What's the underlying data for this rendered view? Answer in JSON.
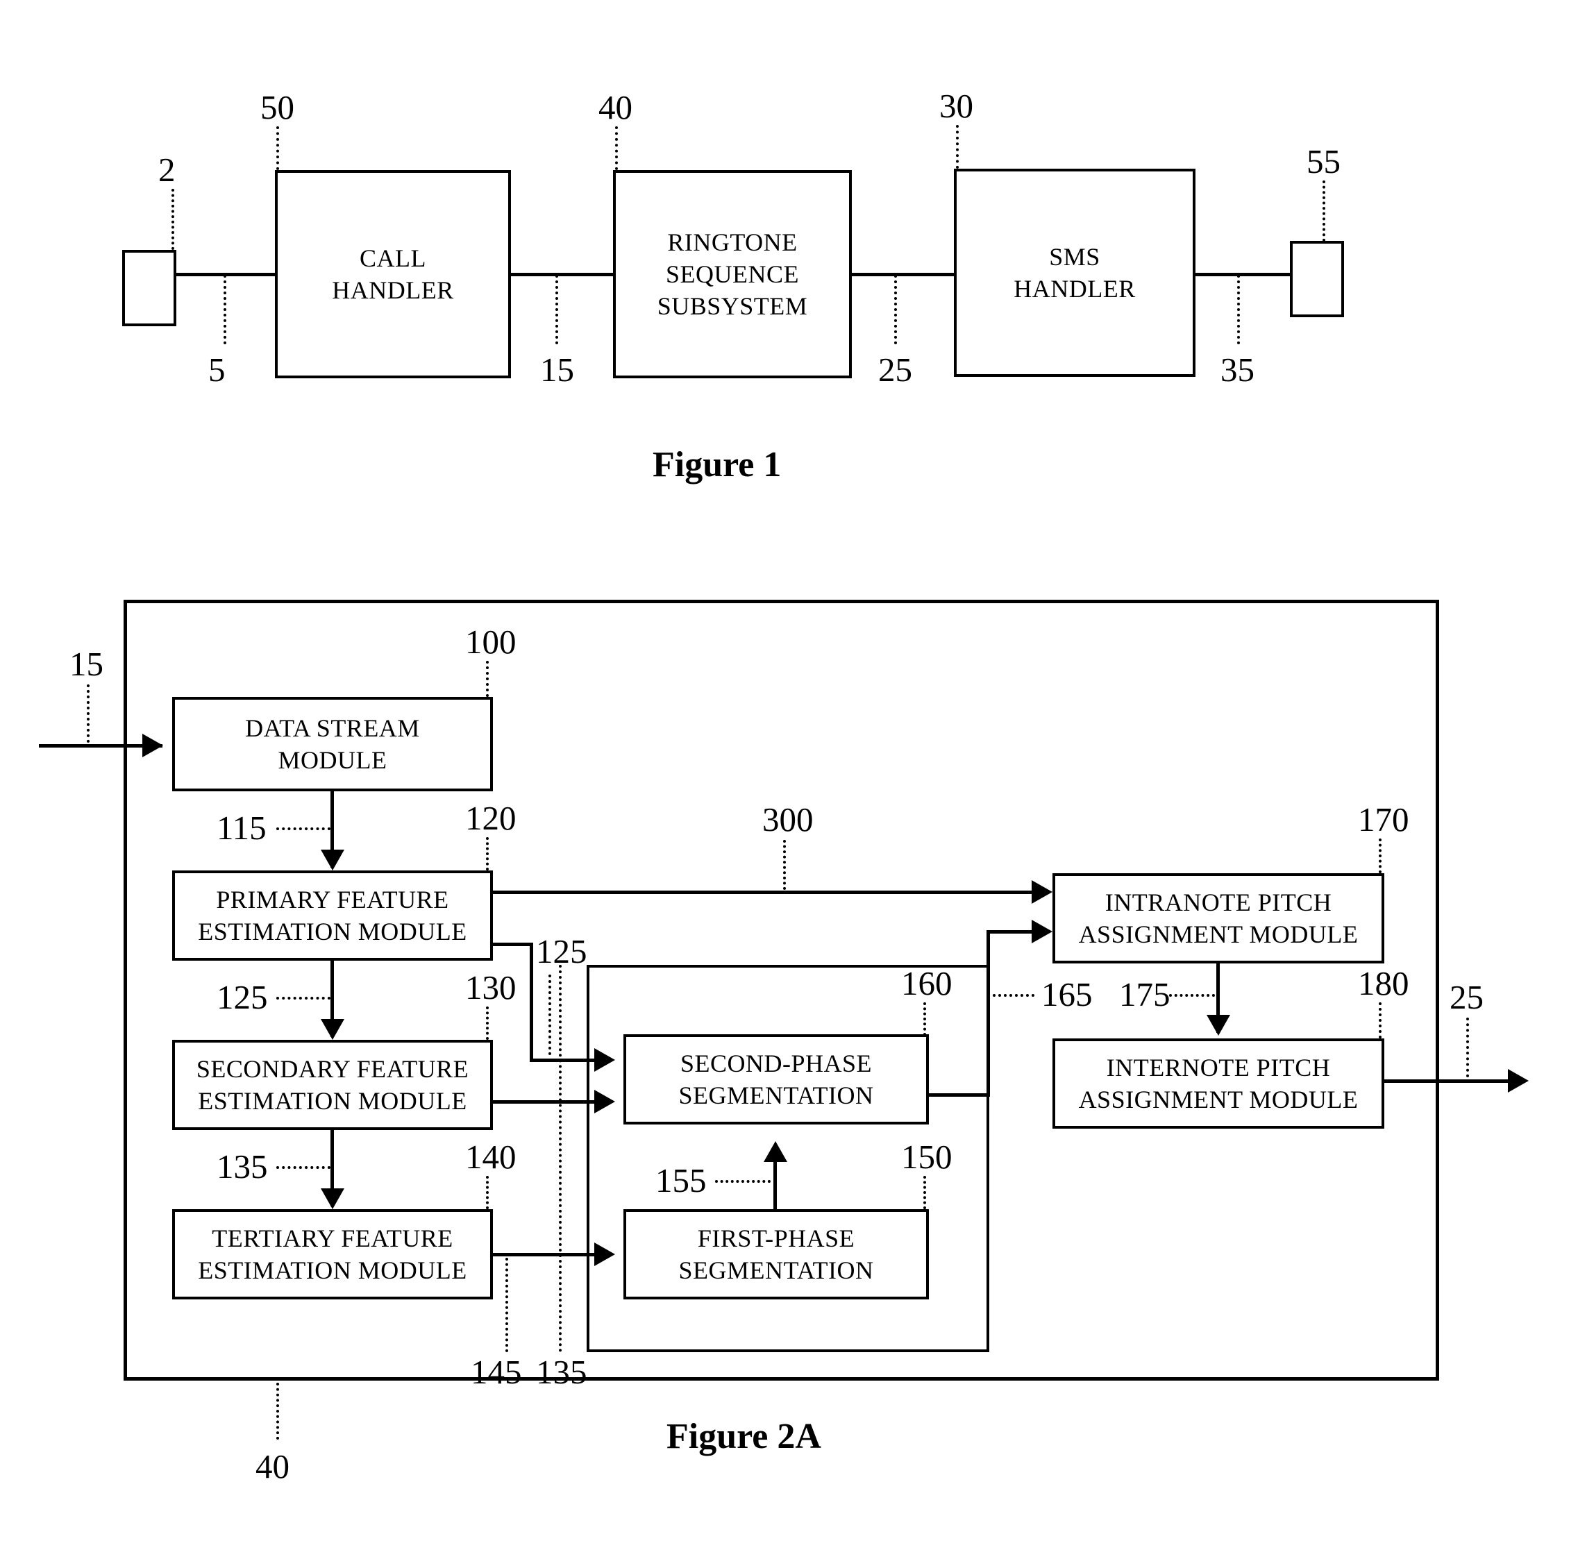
{
  "figure1": {
    "caption": "Figure 1",
    "terminals": [
      {
        "ref": "2"
      },
      {
        "ref": "55"
      }
    ],
    "blocks": [
      {
        "ref": "50",
        "lines": [
          "CALL",
          "HANDLER"
        ]
      },
      {
        "ref": "40",
        "lines": [
          "RINGTONE",
          "SEQUENCE",
          "SUBSYSTEM"
        ]
      },
      {
        "ref": "30",
        "lines": [
          "SMS",
          "HANDLER"
        ]
      }
    ],
    "link_refs": [
      "5",
      "15",
      "25",
      "35"
    ]
  },
  "figure2a": {
    "caption": "Figure 2A",
    "system_ref": "40",
    "input_ref": "15",
    "output_ref": "25",
    "group_ref": "300",
    "blocks": [
      {
        "ref": "100",
        "lines": [
          "DATA STREAM",
          "MODULE"
        ]
      },
      {
        "ref": "120",
        "lines": [
          "PRIMARY FEATURE",
          "ESTIMATION MODULE"
        ]
      },
      {
        "ref": "130",
        "lines": [
          "SECONDARY FEATURE",
          "ESTIMATION MODULE"
        ]
      },
      {
        "ref": "140",
        "lines": [
          "TERTIARY FEATURE",
          "ESTIMATION MODULE"
        ]
      },
      {
        "ref": "160",
        "lines": [
          "SECOND-PHASE",
          "SEGMENTATION"
        ]
      },
      {
        "ref": "150",
        "lines": [
          "FIRST-PHASE",
          "SEGMENTATION"
        ]
      },
      {
        "ref": "170",
        "lines": [
          "INTRANOTE PITCH",
          "ASSIGNMENT MODULE"
        ]
      },
      {
        "ref": "180",
        "lines": [
          "INTERNOTE PITCH",
          "ASSIGNMENT MODULE"
        ]
      }
    ],
    "signal_refs": [
      "115",
      "125",
      "125b",
      "135",
      "135b",
      "145",
      "155",
      "165",
      "175"
    ],
    "signal_values": {
      "s115": "115",
      "s125_left": "125",
      "s125_right": "125",
      "s135_left": "135",
      "s135_right": "135",
      "s145": "145",
      "s155": "155",
      "s165": "165",
      "s175": "175"
    }
  },
  "colors": {
    "ink": "#000000",
    "paper": "#ffffff"
  }
}
